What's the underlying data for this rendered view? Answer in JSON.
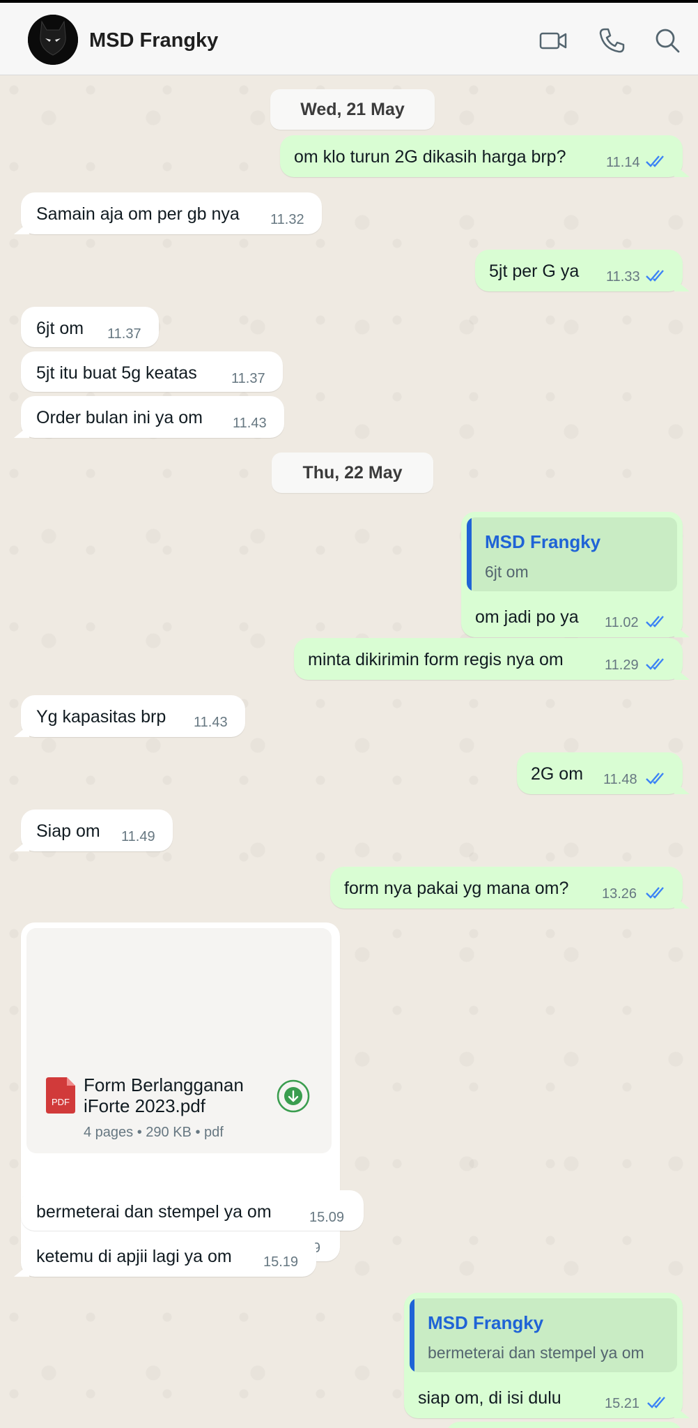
{
  "header": {
    "contact_name": "MSD Frangky",
    "icons": [
      "avatar",
      "video-call-icon",
      "voice-call-icon",
      "search-icon"
    ]
  },
  "chat": {
    "dates": [
      "Wed, 21 May",
      "Thu, 22 May"
    ],
    "messages": [
      {
        "dir": "out",
        "text": "om klo turun 2G dikasih harga brp?",
        "time": "11.14",
        "status": "read"
      },
      {
        "dir": "in",
        "text": "Samain aja om per gb nya",
        "time": "11.32"
      },
      {
        "dir": "out",
        "text": "5jt per G ya",
        "time": "11.33",
        "status": "read"
      },
      {
        "dir": "in",
        "text": "6jt om",
        "time": "11.37"
      },
      {
        "dir": "in",
        "text": "5jt itu buat 5g keatas",
        "time": "11.37"
      },
      {
        "dir": "in",
        "text": "Order bulan ini ya om",
        "time": "11.43"
      },
      {
        "dir": "out",
        "quote_name": "MSD Frangky",
        "quote_text": "6jt om",
        "text": "om jadi po ya",
        "time": "11.02",
        "status": "read"
      },
      {
        "dir": "out",
        "text": "minta dikirimin form regis nya om",
        "time": "11.29",
        "status": "read"
      },
      {
        "dir": "in",
        "text": "Yg kapasitas brp",
        "time": "11.43"
      },
      {
        "dir": "out",
        "text": "2G om",
        "time": "11.48",
        "status": "read"
      },
      {
        "dir": "in",
        "text": "Siap om",
        "time": "11.49"
      },
      {
        "dir": "out",
        "text": "form nya pakai yg mana om?",
        "time": "13.26",
        "status": "read"
      },
      {
        "dir": "in",
        "type": "document",
        "doc_name_line1": "Form Berlangganan",
        "doc_name_line2": "iForte 2023.pdf",
        "doc_meta": "4 pages • 290 KB • pdf",
        "doc_icon_label": "PDF",
        "time": "15.09"
      },
      {
        "dir": "in",
        "text": "bermeterai dan stempel ya om",
        "time": "15.09"
      },
      {
        "dir": "in",
        "text": "ketemu di apjii lagi ya om",
        "time": "15.19"
      },
      {
        "dir": "out",
        "quote_name": "MSD Frangky",
        "quote_text": "bermeterai dan stempel ya om",
        "text": "siap om, di isi dulu",
        "time": "15.21",
        "status": "read"
      }
    ]
  },
  "colors": {
    "incoming_bubble": "#ffffff",
    "outgoing_bubble": "#d9fdd3",
    "read_ticks": "#3b82f6",
    "quote_accent": "#1f63d6",
    "wallpaper": "#efeae2",
    "pdf_red": "#d13a3a",
    "download_green": "#3a9d4f"
  }
}
